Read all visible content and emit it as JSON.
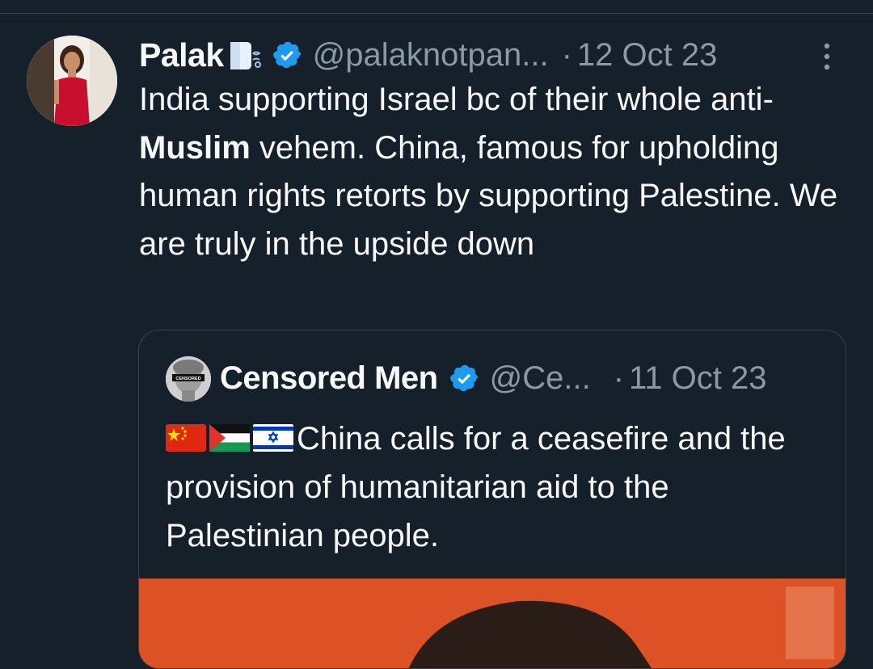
{
  "tweet": {
    "author_name": "Palak",
    "author_emoji": "dashing-away-icon",
    "handle": "@palaknotpan...",
    "separator": "·",
    "date": "12 Oct 23",
    "text_part1": "India supporting Israel bc of their whole anti-",
    "text_bold": "Muslim",
    "text_part2": " vehem. China, famous for upholding human rights retorts by supporting Palestine. We are truly in the upside down"
  },
  "quoted_tweet": {
    "author_name": "Censored Men",
    "handle": "@Ce...",
    "separator": "·",
    "date": "11 Oct 23",
    "flags": [
      "china-flag-icon",
      "palestine-flag-icon",
      "israel-flag-icon"
    ],
    "text": "China calls for a ceasefire and the provision of humanitarian aid to the Palestinian people.",
    "avatar_caption": "CENSORED"
  },
  "colors": {
    "background": "#15202b",
    "text": "#f7f9f9",
    "muted": "#8b98a5",
    "verified": "#1d9bf0",
    "border": "#38444d"
  }
}
